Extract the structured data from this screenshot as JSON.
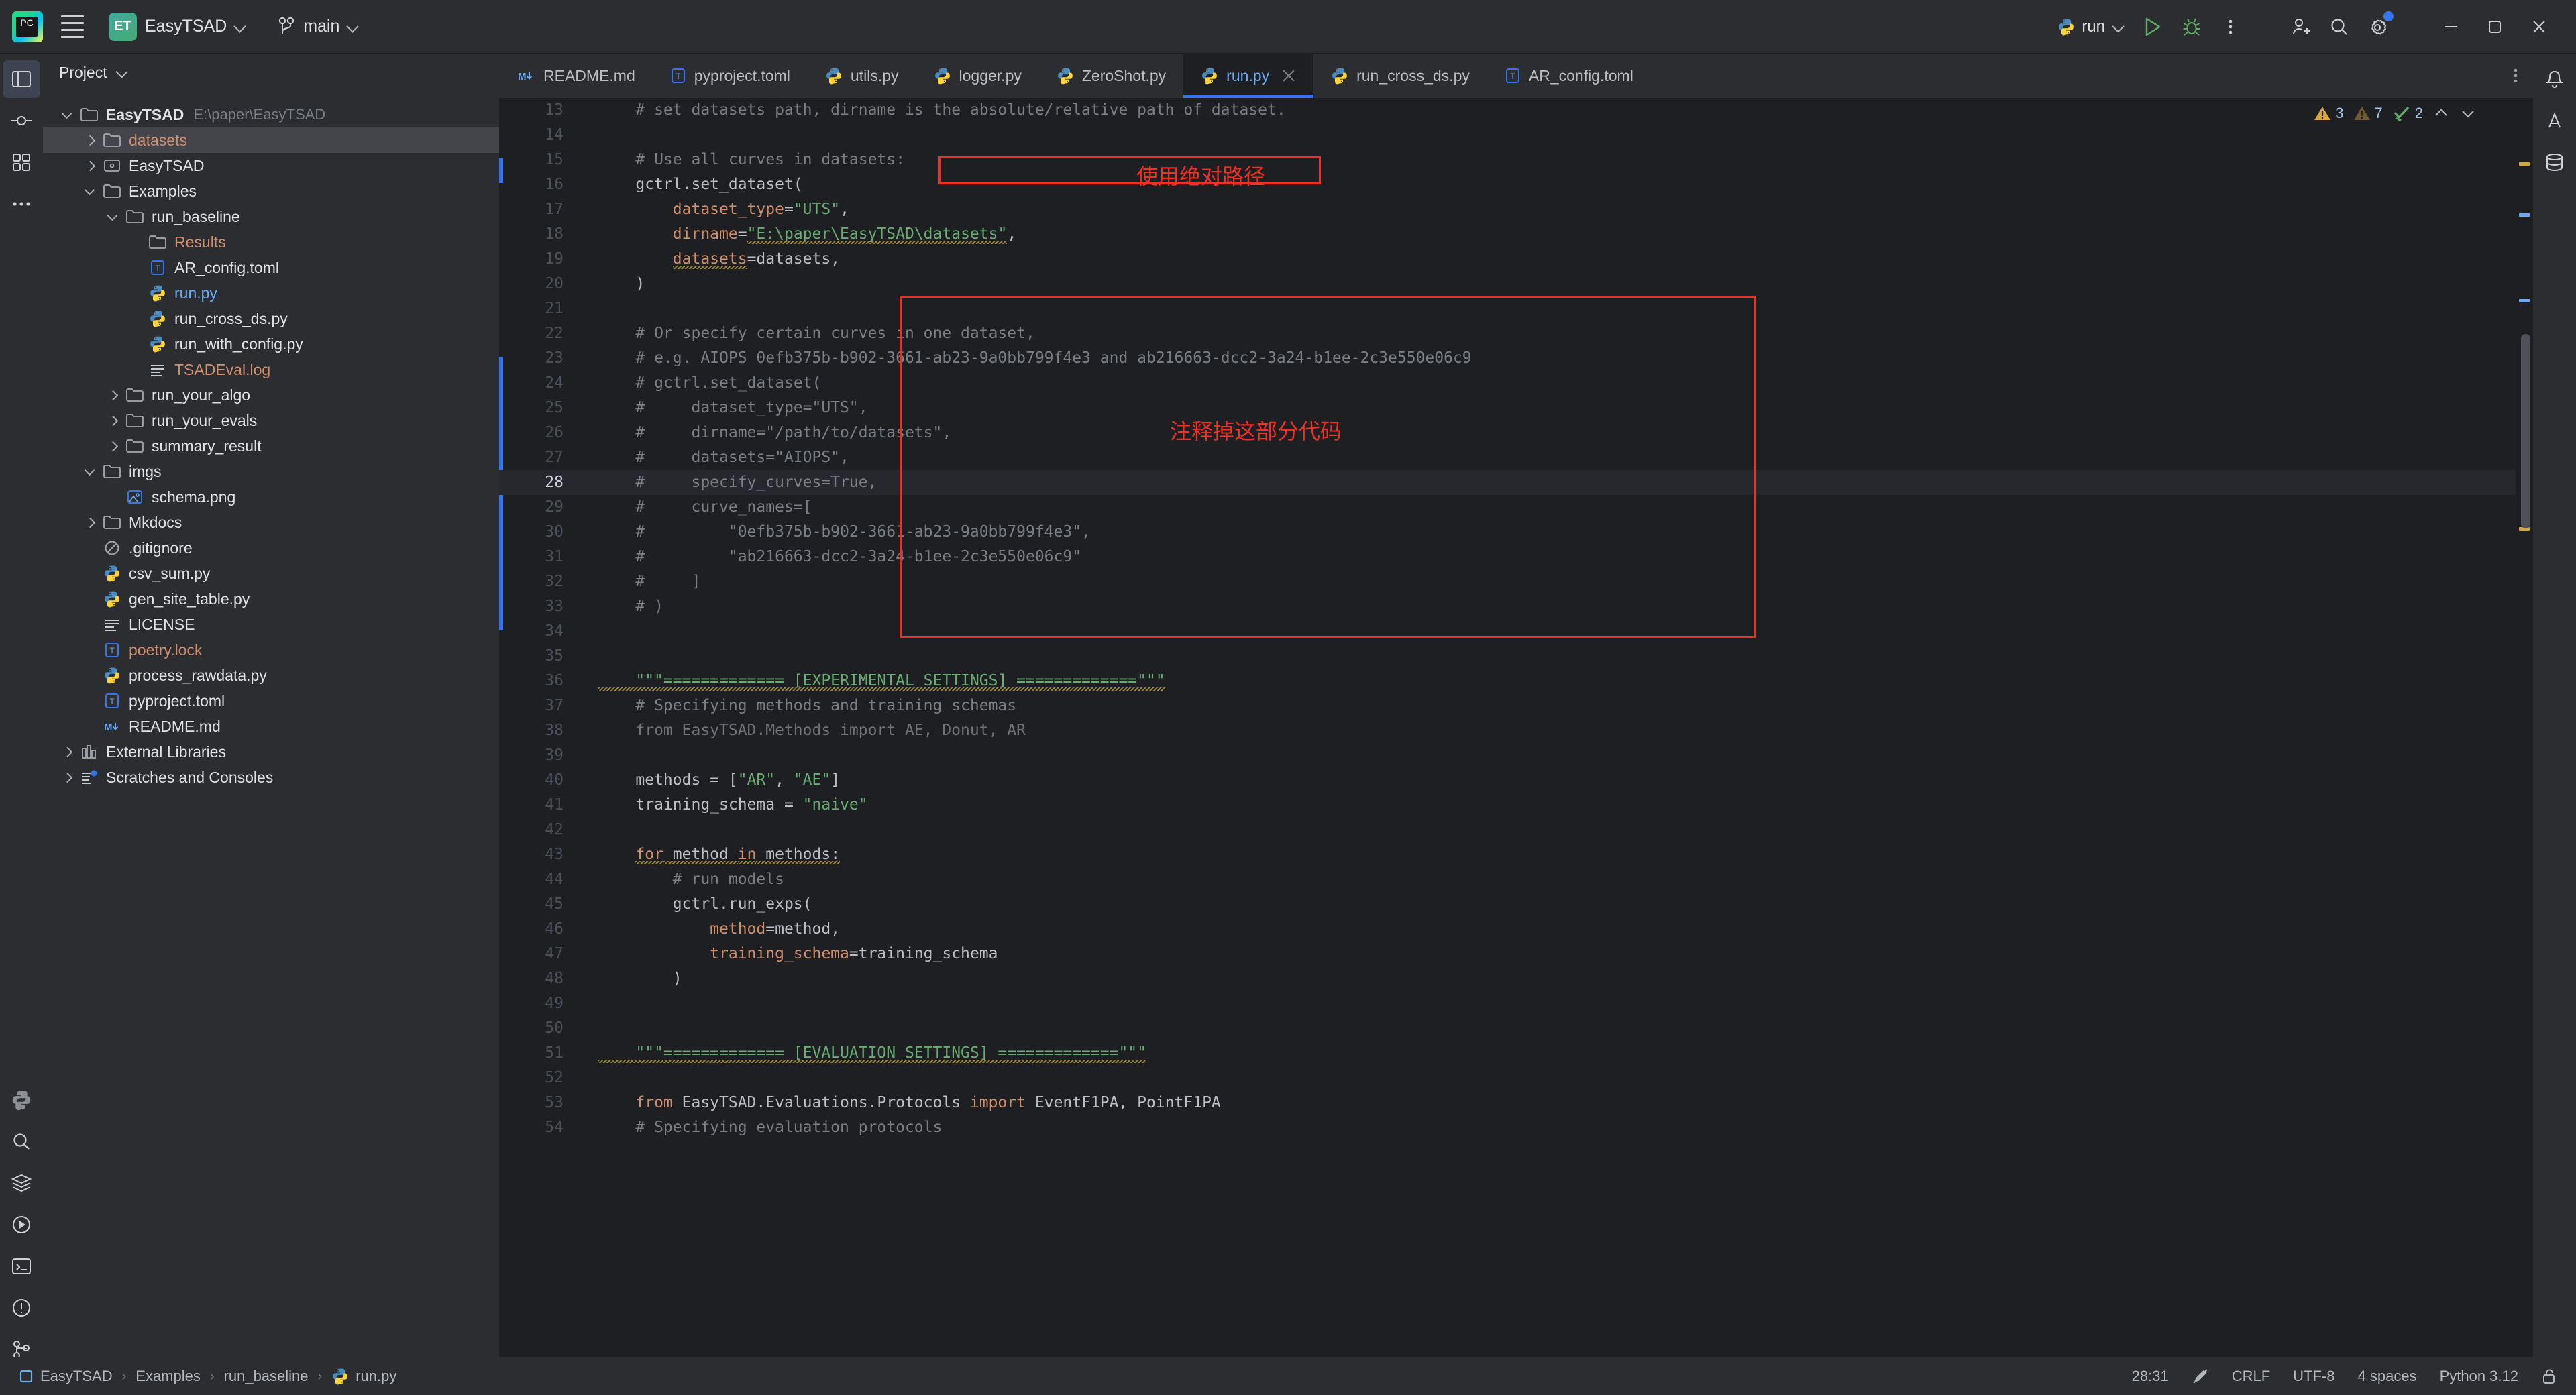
{
  "titlebar": {
    "app_icon": "pycharm-icon",
    "menu_icon": "hamburger-menu-icon",
    "project_badge": "ET",
    "project_name": "EasyTSAD",
    "branch_name": "main",
    "run_config": "run",
    "run_icon": "play-icon",
    "debug_icon": "debug-bug-icon",
    "more_icon": "more-vertical-icon",
    "account_icon": "add-user-icon",
    "search_icon": "search-icon",
    "settings_icon": "gear-icon",
    "minimize": "minimize-icon",
    "maximize": "maximize-icon",
    "close": "close-icon"
  },
  "project_panel": {
    "title": "Project",
    "tree": [
      {
        "depth": 0,
        "twisty": "open",
        "icon": "folder",
        "label": "EasyTSAD",
        "style": "bold",
        "path": "E:\\paper\\EasyTSAD"
      },
      {
        "depth": 1,
        "twisty": "closed",
        "icon": "folder",
        "label": "datasets",
        "style": "orange",
        "selected": true
      },
      {
        "depth": 1,
        "twisty": "closed",
        "icon": "module",
        "label": "EasyTSAD",
        "style": ""
      },
      {
        "depth": 1,
        "twisty": "open",
        "icon": "folder",
        "label": "Examples",
        "style": ""
      },
      {
        "depth": 2,
        "twisty": "open",
        "icon": "folder",
        "label": "run_baseline",
        "style": ""
      },
      {
        "depth": 3,
        "twisty": "none",
        "icon": "folder",
        "label": "Results",
        "style": "orange"
      },
      {
        "depth": 3,
        "twisty": "none",
        "icon": "toml",
        "label": "AR_config.toml",
        "style": ""
      },
      {
        "depth": 3,
        "twisty": "none",
        "icon": "python",
        "label": "run.py",
        "style": "blue"
      },
      {
        "depth": 3,
        "twisty": "none",
        "icon": "python",
        "label": "run_cross_ds.py",
        "style": ""
      },
      {
        "depth": 3,
        "twisty": "none",
        "icon": "python",
        "label": "run_with_config.py",
        "style": ""
      },
      {
        "depth": 3,
        "twisty": "none",
        "icon": "text",
        "label": "TSADEval.log",
        "style": "orange"
      },
      {
        "depth": 2,
        "twisty": "closed",
        "icon": "folder",
        "label": "run_your_algo",
        "style": ""
      },
      {
        "depth": 2,
        "twisty": "closed",
        "icon": "folder",
        "label": "run_your_evals",
        "style": ""
      },
      {
        "depth": 2,
        "twisty": "closed",
        "icon": "folder",
        "label": "summary_result",
        "style": ""
      },
      {
        "depth": 1,
        "twisty": "open",
        "icon": "folder",
        "label": "imgs",
        "style": ""
      },
      {
        "depth": 2,
        "twisty": "none",
        "icon": "image",
        "label": "schema.png",
        "style": ""
      },
      {
        "depth": 1,
        "twisty": "closed",
        "icon": "folder",
        "label": "Mkdocs",
        "style": ""
      },
      {
        "depth": 1,
        "twisty": "none",
        "icon": "gitignore",
        "label": ".gitignore",
        "style": ""
      },
      {
        "depth": 1,
        "twisty": "none",
        "icon": "python",
        "label": "csv_sum.py",
        "style": ""
      },
      {
        "depth": 1,
        "twisty": "none",
        "icon": "python",
        "label": "gen_site_table.py",
        "style": ""
      },
      {
        "depth": 1,
        "twisty": "none",
        "icon": "text",
        "label": "LICENSE",
        "style": ""
      },
      {
        "depth": 1,
        "twisty": "none",
        "icon": "toml",
        "label": "poetry.lock",
        "style": "orange"
      },
      {
        "depth": 1,
        "twisty": "none",
        "icon": "python",
        "label": "process_rawdata.py",
        "style": ""
      },
      {
        "depth": 1,
        "twisty": "none",
        "icon": "toml",
        "label": "pyproject.toml",
        "style": ""
      },
      {
        "depth": 1,
        "twisty": "none",
        "icon": "md",
        "label": "README.md",
        "style": ""
      },
      {
        "depth": 0,
        "twisty": "closed",
        "icon": "libs",
        "label": "External Libraries",
        "style": ""
      },
      {
        "depth": 0,
        "twisty": "closed",
        "icon": "scratch",
        "label": "Scratches and Consoles",
        "style": ""
      }
    ]
  },
  "editor": {
    "tabs": [
      {
        "label": "README.md",
        "icon": "md",
        "active": false,
        "closable": false
      },
      {
        "label": "pyproject.toml",
        "icon": "toml",
        "active": false,
        "closable": false
      },
      {
        "label": "utils.py",
        "icon": "python",
        "active": false,
        "closable": false
      },
      {
        "label": "logger.py",
        "icon": "python",
        "active": false,
        "closable": false
      },
      {
        "label": "ZeroShot.py",
        "icon": "python",
        "active": false,
        "closable": false
      },
      {
        "label": "run.py",
        "icon": "python",
        "active": true,
        "closable": true
      },
      {
        "label": "run_cross_ds.py",
        "icon": "python",
        "active": false,
        "closable": false
      },
      {
        "label": "AR_config.toml",
        "icon": "toml",
        "active": false,
        "closable": false
      }
    ],
    "tabbar_more_icon": "more-vertical-icon",
    "inspections": {
      "warnings_count": "3",
      "weak_warnings_count": "7",
      "checked_count": "2",
      "prev_icon": "chevron-up-icon",
      "next_icon": "chevron-down-icon"
    },
    "first_line_number": 13,
    "current_line": 28,
    "lines": [
      {
        "n": 13,
        "tokens": [
          {
            "t": "    # set datasets path, dirname is the absolute/relative path of dataset.",
            "c": "cm"
          }
        ]
      },
      {
        "n": 14,
        "tokens": []
      },
      {
        "n": 15,
        "tokens": [
          {
            "t": "    # Use all curves in datasets:",
            "c": "cm"
          }
        ]
      },
      {
        "n": 16,
        "tokens": [
          {
            "t": "    gctrl.set_dataset(",
            "c": "pl"
          }
        ]
      },
      {
        "n": 17,
        "tokens": [
          {
            "t": "        ",
            "c": "pl"
          },
          {
            "t": "dataset_type",
            "c": "kw"
          },
          {
            "t": "=",
            "c": "pl"
          },
          {
            "t": "\"UTS\"",
            "c": "str"
          },
          {
            "t": ",",
            "c": "pl"
          }
        ]
      },
      {
        "n": 18,
        "tokens": [
          {
            "t": "        ",
            "c": "pl"
          },
          {
            "t": "dirname",
            "c": "kw"
          },
          {
            "t": "=",
            "c": "pl"
          },
          {
            "t": "\"E:\\paper\\EasyTSAD\\datasets\"",
            "c": "str wav"
          },
          {
            "t": ",",
            "c": "pl"
          }
        ]
      },
      {
        "n": 19,
        "tokens": [
          {
            "t": "        ",
            "c": "pl"
          },
          {
            "t": "datasets",
            "c": "kw wav"
          },
          {
            "t": "=datasets,",
            "c": "pl"
          }
        ]
      },
      {
        "n": 20,
        "tokens": [
          {
            "t": "    )",
            "c": "pl"
          }
        ]
      },
      {
        "n": 21,
        "tokens": []
      },
      {
        "n": 22,
        "tokens": [
          {
            "t": "    # Or specify certain curves in one dataset,",
            "c": "cm"
          }
        ]
      },
      {
        "n": 23,
        "tokens": [
          {
            "t": "    # e.g. AIOPS 0efb375b-b902-3661-ab23-9a0bb799f4e3 and ab216663-dcc2-3a24-b1ee-2c3e550e06c9",
            "c": "cm"
          }
        ]
      },
      {
        "n": 24,
        "tokens": [
          {
            "t": "    # ",
            "c": "cm"
          },
          {
            "t": "gctrl",
            "c": "cm wavg"
          },
          {
            "t": ".set_dataset(",
            "c": "cm"
          }
        ]
      },
      {
        "n": 25,
        "tokens": [
          {
            "t": "    #     dataset_type=\"UTS\",",
            "c": "cm"
          }
        ]
      },
      {
        "n": 26,
        "tokens": [
          {
            "t": "    #     dirname=\"/path/to/datasets\",",
            "c": "cm"
          }
        ]
      },
      {
        "n": 27,
        "tokens": [
          {
            "t": "    #     datasets=\"AIOPS\",",
            "c": "cm"
          }
        ]
      },
      {
        "n": 28,
        "tokens": [
          {
            "t": "    #     specify_curves=True,",
            "c": "cm"
          }
        ]
      },
      {
        "n": 29,
        "tokens": [
          {
            "t": "    #     curve_names=[",
            "c": "cm"
          }
        ]
      },
      {
        "n": 30,
        "tokens": [
          {
            "t": "    #         \"0efb375b-b902-3661-ab23-9a0bb799f4e3\",",
            "c": "cm"
          }
        ]
      },
      {
        "n": 31,
        "tokens": [
          {
            "t": "    #         \"ab216663-dcc2-3a24-b1ee-2c3e550e06c9\"",
            "c": "cm"
          }
        ]
      },
      {
        "n": 32,
        "tokens": [
          {
            "t": "    #     ]",
            "c": "cm"
          }
        ]
      },
      {
        "n": 33,
        "tokens": [
          {
            "t": "    # )",
            "c": "cm"
          }
        ]
      },
      {
        "n": 34,
        "tokens": []
      },
      {
        "n": 35,
        "tokens": []
      },
      {
        "n": 36,
        "tokens": [
          {
            "t": "    \"\"\"============= [EXPERIMENTAL SETTINGS] =============\"\"\"",
            "c": "str wav"
          }
        ]
      },
      {
        "n": 37,
        "tokens": [
          {
            "t": "    # Specifying methods and training schemas",
            "c": "cm"
          }
        ]
      },
      {
        "n": 38,
        "tokens": [
          {
            "t": "    from EasyTSAD.Methods import AE, Donut, AR",
            "c": "dim"
          }
        ]
      },
      {
        "n": 39,
        "tokens": []
      },
      {
        "n": 40,
        "tokens": [
          {
            "t": "    methods = [",
            "c": "pl"
          },
          {
            "t": "\"AR\"",
            "c": "str"
          },
          {
            "t": ", ",
            "c": "pl"
          },
          {
            "t": "\"AE\"",
            "c": "str"
          },
          {
            "t": "]",
            "c": "pl"
          }
        ]
      },
      {
        "n": 41,
        "tokens": [
          {
            "t": "    training_schema = ",
            "c": "pl"
          },
          {
            "t": "\"naive\"",
            "c": "str"
          }
        ]
      },
      {
        "n": 42,
        "tokens": []
      },
      {
        "n": 43,
        "tokens": [
          {
            "t": "    ",
            "c": "pl"
          },
          {
            "t": "for",
            "c": "kw wav"
          },
          {
            "t": " method ",
            "c": "pl wav"
          },
          {
            "t": "in",
            "c": "kw wav"
          },
          {
            "t": " methods:",
            "c": "pl wav"
          }
        ]
      },
      {
        "n": 44,
        "tokens": [
          {
            "t": "        # run models",
            "c": "cm"
          }
        ]
      },
      {
        "n": 45,
        "tokens": [
          {
            "t": "        gctrl.run_exps(",
            "c": "pl"
          }
        ]
      },
      {
        "n": 46,
        "tokens": [
          {
            "t": "            ",
            "c": "pl"
          },
          {
            "t": "method",
            "c": "kw"
          },
          {
            "t": "=method,",
            "c": "pl"
          }
        ]
      },
      {
        "n": 47,
        "tokens": [
          {
            "t": "            ",
            "c": "pl"
          },
          {
            "t": "training_schema",
            "c": "kw"
          },
          {
            "t": "=training_schema",
            "c": "pl"
          }
        ]
      },
      {
        "n": 48,
        "tokens": [
          {
            "t": "        )",
            "c": "pl"
          }
        ]
      },
      {
        "n": 49,
        "tokens": []
      },
      {
        "n": 50,
        "tokens": []
      },
      {
        "n": 51,
        "tokens": [
          {
            "t": "    \"\"\"============= [EVALUATION SETTINGS] =============\"\"\"",
            "c": "str wav"
          }
        ]
      },
      {
        "n": 52,
        "tokens": []
      },
      {
        "n": 53,
        "tokens": [
          {
            "t": "    ",
            "c": "pl"
          },
          {
            "t": "from",
            "c": "kw"
          },
          {
            "t": " EasyTSAD.Evaluations.Protocols ",
            "c": "pl"
          },
          {
            "t": "import",
            "c": "kw"
          },
          {
            "t": " EventF1PA, PointF1PA",
            "c": "pl"
          }
        ]
      },
      {
        "n": 54,
        "tokens": [
          {
            "t": "    # Specifying evaluation protocols",
            "c": "cm"
          }
        ]
      }
    ],
    "annotations": [
      {
        "id": "ann-absolute-path",
        "text": "使用绝对路径"
      },
      {
        "id": "ann-comment-out",
        "text": "注释掉这部分代码"
      }
    ]
  },
  "statusbar": {
    "breadcrumbs": [
      {
        "label": "EasyTSAD",
        "icon": "project-icon"
      },
      {
        "label": "Examples",
        "icon": ""
      },
      {
        "label": "run_baseline",
        "icon": ""
      },
      {
        "label": "run.py",
        "icon": "python"
      }
    ],
    "caret_position": "28:31",
    "no_edit_icon": "crossed-pencil-icon",
    "line_separator": "CRLF",
    "encoding": "UTF-8",
    "indent": "4 spaces",
    "interpreter": "Python 3.12",
    "lock_icon": "unlocked-padlock-icon"
  },
  "colors": {
    "accent_blue": "#3574f0",
    "annotation_red": "#f02f25",
    "string_green": "#6aab73",
    "keyword_orange": "#cf8e6d",
    "comment_gray": "#7a7e85"
  }
}
